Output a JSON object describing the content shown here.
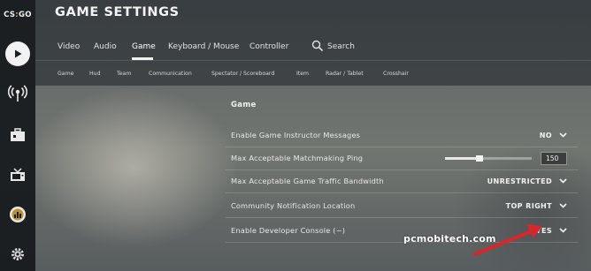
{
  "app": {
    "logo": {
      "left": "CS",
      "sep": ":",
      "right": "GO"
    },
    "title": "GAME SETTINGS"
  },
  "sidebar": {
    "items": [
      {
        "name": "play-icon"
      },
      {
        "name": "broadcast-icon"
      },
      {
        "name": "inventory-briefcase-icon"
      },
      {
        "name": "tv-icon"
      },
      {
        "name": "stats-badge-icon"
      },
      {
        "name": "settings-gear-icon"
      }
    ]
  },
  "tabs": {
    "video": "Video",
    "audio": "Audio",
    "game": "Game",
    "keyboard_mouse": "Keyboard / Mouse",
    "controller": "Controller",
    "search": "Search",
    "active": "Game"
  },
  "subtabs": {
    "game": "Game",
    "hud": "Hud",
    "team": "Team",
    "communication": "Communication",
    "spectator": "Spectator / Scoreboard",
    "item": "Item",
    "radar": "Radar / Tablet",
    "crosshair": "Crosshair"
  },
  "panel": {
    "section_title": "Game",
    "rows": {
      "instructor": {
        "label": "Enable Game Instructor Messages",
        "value": "NO"
      },
      "ping": {
        "label": "Max Acceptable Matchmaking Ping",
        "value": "150",
        "slider_fraction": 0.4
      },
      "bandwidth": {
        "label": "Max Acceptable Game Traffic Bandwidth",
        "value": "UNRESTRICTED"
      },
      "notification": {
        "label": "Community Notification Location",
        "value": "TOP RIGHT"
      },
      "console": {
        "label": "Enable Developer Console (~)",
        "value": "YES"
      }
    }
  },
  "watermark": "pcmobitech.com",
  "colors": {
    "annotation_arrow": "#d9262b",
    "accent_logo": "#c9a24c"
  }
}
